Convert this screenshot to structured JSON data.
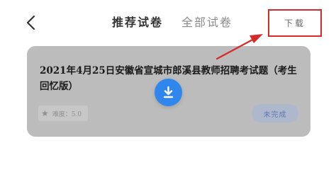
{
  "header": {
    "tabs": [
      {
        "label": "推荐试卷",
        "active": true
      },
      {
        "label": "全部试卷",
        "active": false
      }
    ],
    "download_label": "下载"
  },
  "card": {
    "title": "2021年4月25日安徽省宣城市郎溪县教师招聘考试题（考生回忆版）",
    "difficulty": "难度：5.0",
    "status": "未完成"
  },
  "icons": {
    "back": "chevron-left-icon",
    "download": "download-icon",
    "star": "star-icon",
    "annotation": "red-arrow"
  },
  "colors": {
    "accent": "#2f86ec",
    "annotation": "#d52b2b",
    "overlay": "#bcbcbc"
  }
}
